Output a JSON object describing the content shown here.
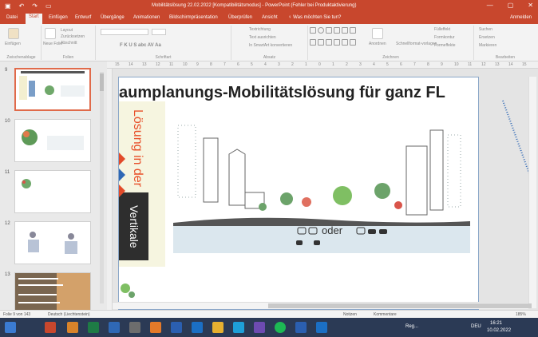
{
  "window": {
    "title": "Mobilitätslösung 22.02.2022 [Kompatibilitätsmodus] - PowerPoint (Fehler bei Produktaktivierung)",
    "minimize": "—",
    "maximize": "▢",
    "close": "✕"
  },
  "quick_access": {
    "save": "▣",
    "undo": "↶",
    "redo": "↷",
    "start": "▭"
  },
  "tabs": [
    "Datei",
    "Start",
    "Einfügen",
    "Entwurf",
    "Übergänge",
    "Animationen",
    "Bildschirmpräsentation",
    "Überprüfen",
    "Ansicht",
    "♀ Was möchten Sie tun?"
  ],
  "active_tab": "Start",
  "sign_in": "Anmelden",
  "ribbon": {
    "clipboard": {
      "paste": "Einfügen",
      "label": "Zwischenablage"
    },
    "slides": {
      "new_slide": "Neue Folie",
      "layout": "Layout",
      "reset": "Zurücksetzen",
      "section": "Abschnitt",
      "label": "Folien"
    },
    "font": {
      "label": "Schriftart",
      "buttons": "F  K  U  S  abc  AV  Aa"
    },
    "paragraph": {
      "label": "Absatz",
      "direction": "Textrichtung",
      "align": "Text ausrichten",
      "smartart": "In SmartArt konvertieren"
    },
    "drawing": {
      "arrange": "Anordnen",
      "quick_styles": "Schnellformat-vorlagen",
      "fill": "Fülleffekt",
      "outline": "Formkontur",
      "effects": "Formeffekte",
      "label": "Zeichnen"
    },
    "editing": {
      "find": "Suchen",
      "replace": "Ersetzen",
      "select": "Markieren",
      "label": "Bearbeiten"
    }
  },
  "ruler_marks": [
    "15",
    "14",
    "13",
    "12",
    "11",
    "10",
    "9",
    "8",
    "7",
    "6",
    "5",
    "4",
    "3",
    "2",
    "1",
    "0",
    "1",
    "2",
    "3",
    "4",
    "5",
    "6",
    "7",
    "8",
    "9",
    "10",
    "11",
    "12",
    "13",
    "14",
    "15"
  ],
  "thumbnails": [
    {
      "num": "9"
    },
    {
      "num": "10"
    },
    {
      "num": "11"
    },
    {
      "num": "12"
    },
    {
      "num": "13"
    }
  ],
  "slide": {
    "title": "aumplanungs-Mobilitätslösung für ganz FL",
    "vtext1": "Lösung in der",
    "vtext2": "Vertikale",
    "oder": "oder"
  },
  "status": {
    "slide": "Folie 9 von 143",
    "lang": "Deutsch (Liechtenstein)",
    "notes": "Notizen",
    "comments": "Kommentare",
    "zoom": "185%"
  },
  "taskbar": {
    "weather": "Reg...",
    "lang": "DEU",
    "time": "16:21",
    "date": "10.02.2022"
  }
}
